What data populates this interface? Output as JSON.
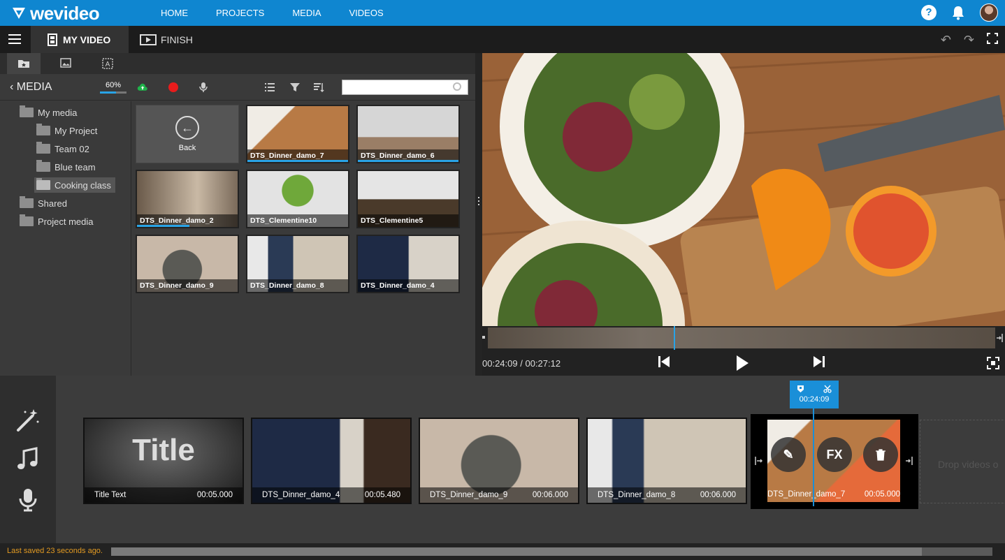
{
  "brand": {
    "name": "wevideo",
    "accent": "#0f86d0"
  },
  "nav": {
    "items": [
      "HOME",
      "PROJECTS",
      "MEDIA",
      "VIDEOS"
    ]
  },
  "header": {
    "help": "?"
  },
  "editor_tabs": {
    "my_video": "MY VIDEO",
    "finish": "FINISH"
  },
  "media": {
    "title": "MEDIA",
    "storage_label": "60%",
    "storage_fraction": 0.6,
    "search_placeholder": ""
  },
  "tree": {
    "items": [
      {
        "label": "My media"
      },
      {
        "label": "My Project"
      },
      {
        "label": "Team 02"
      },
      {
        "label": "Blue team"
      },
      {
        "label": "Cooking class"
      },
      {
        "label": "Shared"
      },
      {
        "label": "Project media"
      }
    ]
  },
  "grid": {
    "back_label": "Back",
    "items": [
      {
        "name": "DTS_Dinner_damo_7",
        "progress": 1.0
      },
      {
        "name": "DTS_Dinner_damo_6",
        "progress": 1.0
      },
      {
        "name": "DTS_Dinner_damo_2",
        "progress": 0.52
      },
      {
        "name": "DTS_Clementine10",
        "progress": 0
      },
      {
        "name": "DTS_Clementine5",
        "progress": 0
      },
      {
        "name": "DTS_Dinner_damo_9",
        "progress": 0
      },
      {
        "name": "DTS_Dinner_damo_8",
        "progress": 0
      },
      {
        "name": "DTS_Dinner_damo_4",
        "progress": 0
      }
    ]
  },
  "player": {
    "current": "00:24:09",
    "total": "00:27:12",
    "separator": "/"
  },
  "timeline": {
    "playhead_time": "00:24:09",
    "clips": [
      {
        "name": "Title Text",
        "duration": "00:05.000",
        "title_text": "Title"
      },
      {
        "name": "DTS_Dinner_damo_4",
        "duration": "00:05.480"
      },
      {
        "name": "DTS_Dinner_damo_9",
        "duration": "00:06.000"
      },
      {
        "name": "DTS_Dinner_damo_8",
        "duration": "00:06.000"
      },
      {
        "name": "DTS_Dinner_damo_7",
        "duration": "00:05.000"
      }
    ],
    "fx_label": "FX",
    "drop_hint": "Drop videos o"
  },
  "status": {
    "last_saved": "Last saved 23 seconds ago."
  }
}
